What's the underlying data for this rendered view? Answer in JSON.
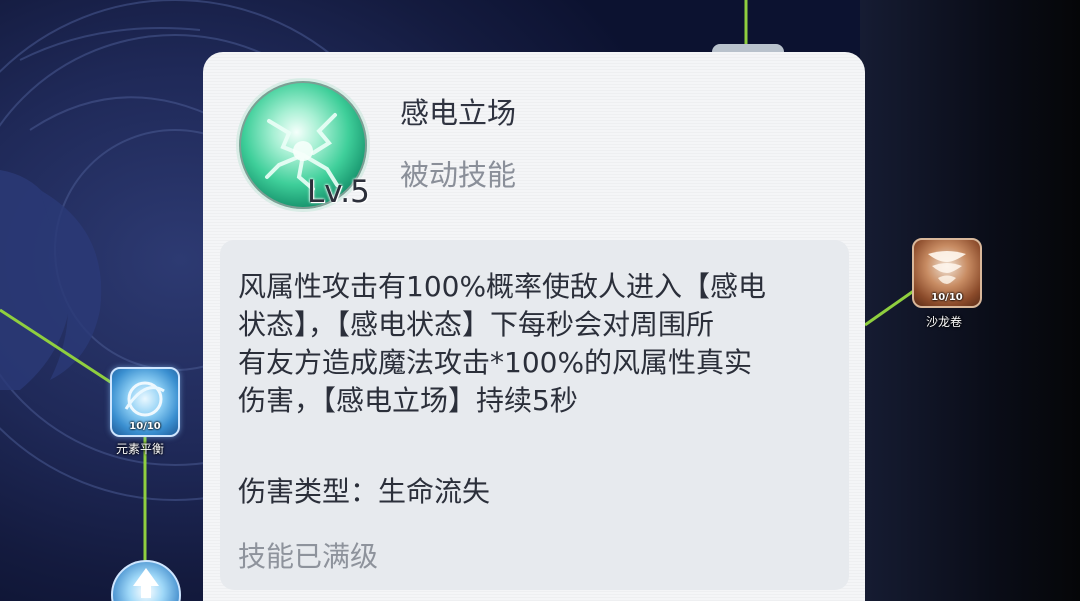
{
  "skill": {
    "name": "感电立场",
    "level": "Lv.5",
    "type": "被动技能",
    "icon": "electric-field-skill-icon",
    "description_lines": [
      "风属性攻击有100%概率使敌人进入【感电",
      "状态】，【感电状态】下每秒会对周围所",
      "有友方造成魔法攻击*100%的风属性真实",
      "伤害，【感电立场】持续5秒"
    ],
    "damage_type": "伤害类型：生命流失",
    "status": "技能已满级"
  },
  "tree_nodes": {
    "left": {
      "level": "10/10",
      "name": "元素平衡"
    },
    "right": {
      "level": "10/10",
      "name": "沙龙卷"
    }
  },
  "colors": {
    "link_line": "#8fcf3f",
    "panel_bg": "#f4f5f7",
    "desc_bg": "#e7eaee",
    "skill_icon": "#3fcf9a"
  }
}
